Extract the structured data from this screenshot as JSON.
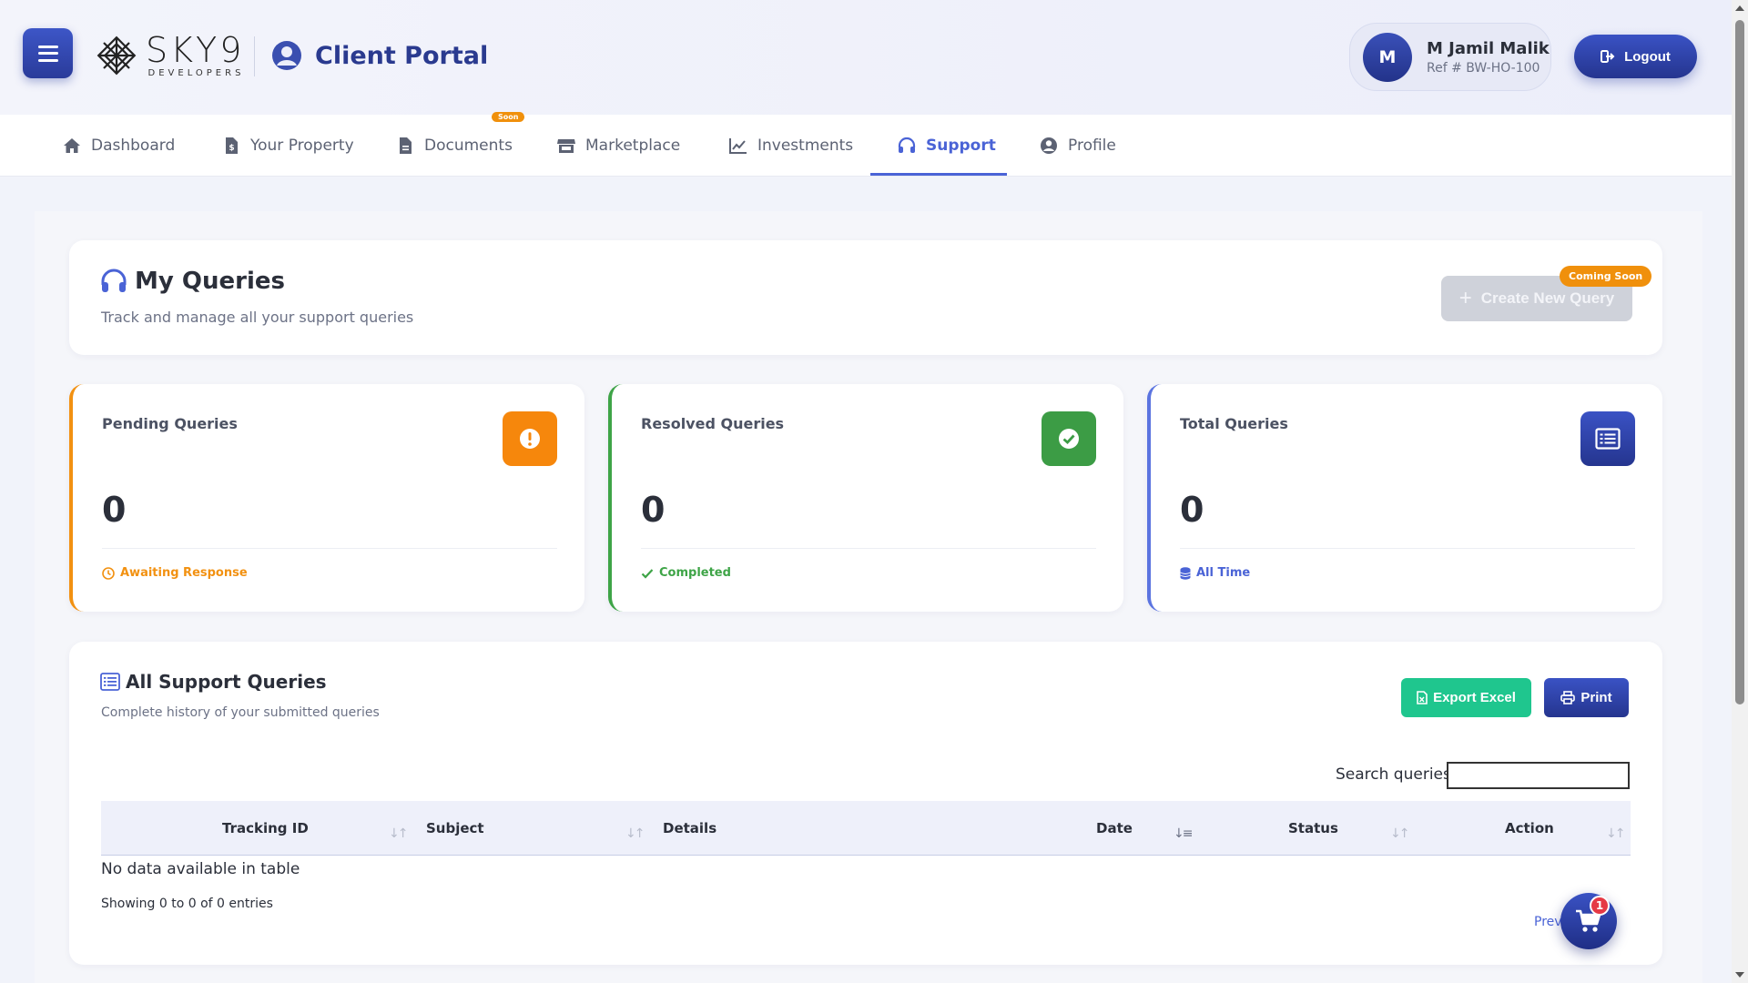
{
  "header": {
    "logo_name": "SKY9",
    "logo_sub": "DEVELOPERS",
    "portal_title": "Client Portal",
    "user": {
      "initial": "M",
      "name": "M Jamil Malik",
      "ref": "Ref # BW-HO-100"
    },
    "logout_label": "Logout"
  },
  "nav": {
    "items": [
      {
        "label": "Dashboard",
        "icon": "home-icon"
      },
      {
        "label": "Your Property",
        "icon": "file-dollar-icon"
      },
      {
        "label": "Documents",
        "icon": "document-icon",
        "badge": "Soon"
      },
      {
        "label": "Marketplace",
        "icon": "store-icon"
      },
      {
        "label": "Investments",
        "icon": "chart-line-icon"
      },
      {
        "label": "Support",
        "icon": "headset-icon",
        "active": true
      },
      {
        "label": "Profile",
        "icon": "user-circle-icon"
      }
    ]
  },
  "queries_header": {
    "title": "My Queries",
    "subtitle": "Track and manage all your support queries",
    "create_label": "Create New Query",
    "coming_badge": "Coming Soon"
  },
  "stats": {
    "pending": {
      "label": "Pending Queries",
      "value": "0",
      "foot": "Awaiting Response",
      "icon": "exclamation-icon"
    },
    "resolved": {
      "label": "Resolved Queries",
      "value": "0",
      "foot": "Completed",
      "icon": "check-circle-icon"
    },
    "total": {
      "label": "Total Queries",
      "value": "0",
      "foot": "All Time",
      "icon": "list-icon"
    }
  },
  "table": {
    "title": "All Support Queries",
    "subtitle": "Complete history of your submitted queries",
    "export_label": "Export Excel",
    "print_label": "Print",
    "search_label": "Search queries:",
    "search_value": "",
    "columns": [
      "Tracking ID",
      "Subject",
      "Details",
      "Date",
      "Status",
      "Action"
    ],
    "empty_text": "No data available in table",
    "showing": "Showing 0 to 0 of 0 entries",
    "prev_label": "Previ"
  },
  "cart": {
    "count": "1"
  },
  "colors": {
    "primary": "#2a3b9a",
    "accent": "#4a63d6",
    "orange": "#f29111",
    "green": "#3ea447",
    "export_green": "#1fc68e"
  }
}
